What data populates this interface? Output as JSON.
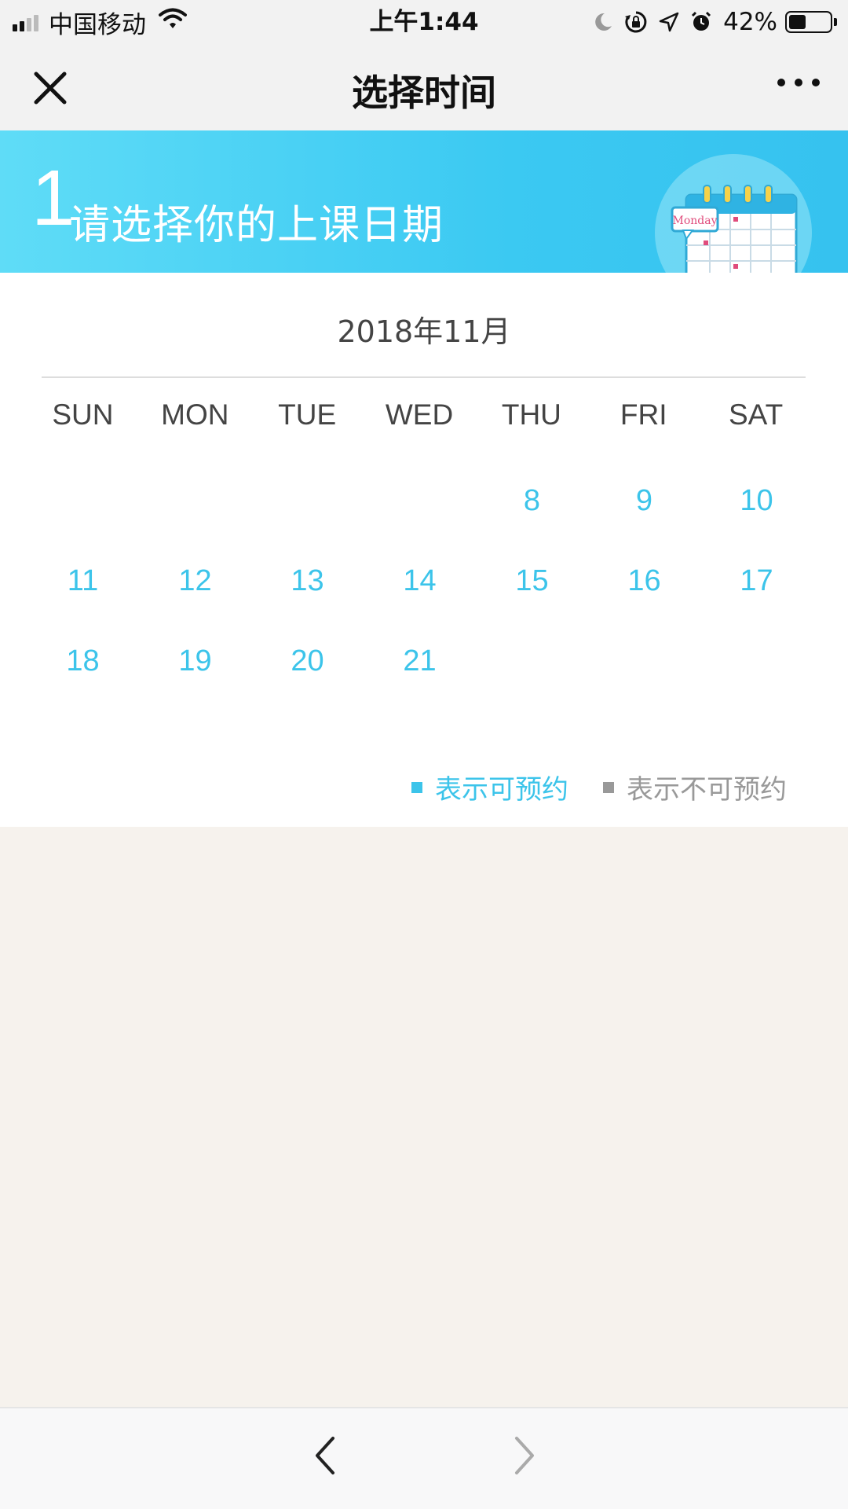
{
  "status_bar": {
    "carrier": "中国移动",
    "time": "上午1:44",
    "battery": "42%",
    "battery_level": 0.42,
    "icons": [
      "signal-icon",
      "wifi-icon",
      "moon-icon",
      "rotation-lock-icon",
      "location-icon",
      "alarm-icon",
      "battery-icon"
    ]
  },
  "nav": {
    "title": "选择时间",
    "icons": [
      "close-icon",
      "more-icon"
    ]
  },
  "banner": {
    "step": "1",
    "text": "请选择你的上课日期",
    "art_label": "Monday",
    "colors": {
      "from": "#5fdcf7",
      "to": "#36c2ef"
    }
  },
  "calendar": {
    "month": "2018年11月",
    "weekdays": [
      "SUN",
      "MON",
      "TUE",
      "WED",
      "THU",
      "FRI",
      "SAT"
    ],
    "weeks": [
      [
        "",
        "",
        "",
        "",
        "8",
        "9",
        "10"
      ],
      [
        "11",
        "12",
        "13",
        "14",
        "15",
        "16",
        "17"
      ],
      [
        "18",
        "19",
        "20",
        "21",
        "",
        "",
        ""
      ]
    ],
    "available_color": "#3cc4ea",
    "unavailable_color": "#999999"
  },
  "legend": {
    "available": "表示可预约",
    "unavailable": "表示不可预约"
  },
  "toolbar": {
    "back_icon": "chevron-left-icon",
    "forward_icon": "chevron-right-icon"
  }
}
